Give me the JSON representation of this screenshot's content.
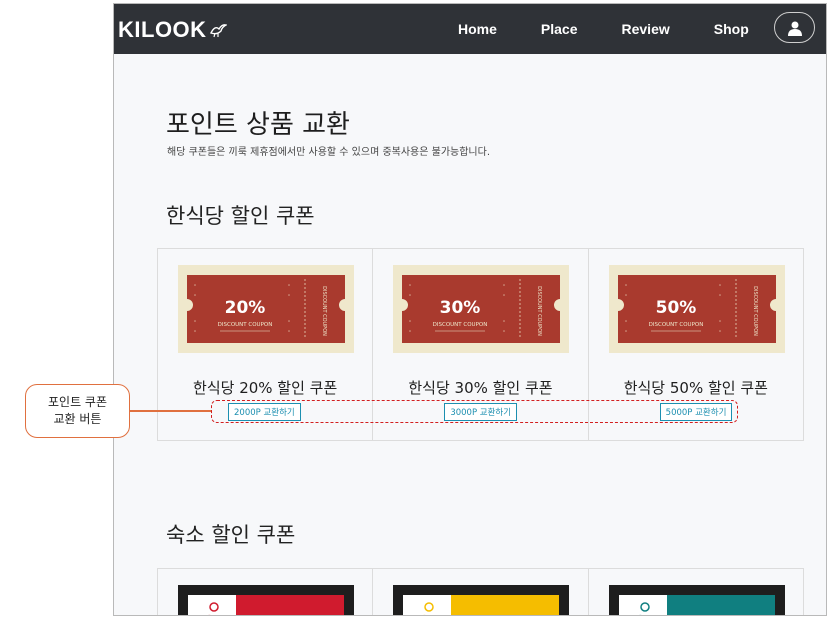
{
  "nav": {
    "logo": "KILOOK",
    "links": [
      "Home",
      "Place",
      "Review",
      "Shop"
    ]
  },
  "page": {
    "title": "포인트 상품 교환",
    "subtitle": "해당 쿠폰들은 끼룩 제휴점에서만 사용할 수 있으며 중복사용은 불가능합니다."
  },
  "sections": [
    {
      "title": "한식당 할인 쿠폰",
      "cards": [
        {
          "percent": "20%",
          "coupon_text": "DISCOUNT COUPON",
          "side_text": "DISCOUNT COUPON",
          "name": "한식당 20% 할인 쿠폰",
          "button": "2000P 교환하기"
        },
        {
          "percent": "30%",
          "coupon_text": "DISCOUNT COUPON",
          "side_text": "DISCOUNT COUPON",
          "name": "한식당 30% 할인 쿠폰",
          "button": "3000P 교환하기"
        },
        {
          "percent": "50%",
          "coupon_text": "DISCOUNT COUPON",
          "side_text": "DISCOUNT COUPON",
          "name": "한식당 50% 할인 쿠폰",
          "button": "5000P 교환하기"
        }
      ]
    },
    {
      "title": "숙소 할인 쿠폰",
      "colors": [
        "#d01b2e",
        "#f5bd00",
        "#107f80"
      ]
    }
  ],
  "annotation": {
    "line1": "포인트 쿠폰",
    "line2": "교환 버튼"
  },
  "colors": {
    "coupon_red": "#a93a2e",
    "coupon_bg": "#efe8cc",
    "nav_bg": "#2f3237",
    "button_teal": "#1c8fb0",
    "annot_orange": "#e0703f",
    "annot_red": "#d21f1f"
  }
}
